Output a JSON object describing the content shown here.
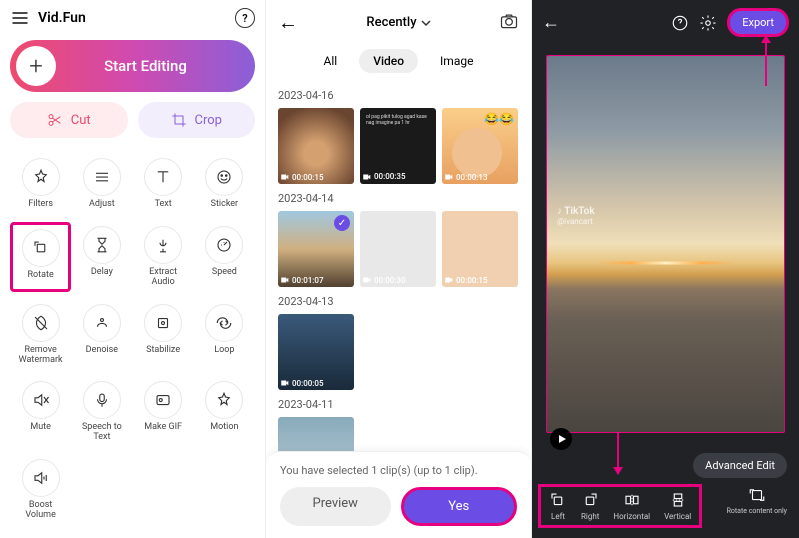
{
  "pane1": {
    "app_name": "Vid.Fun",
    "start_label": "Start Editing",
    "pills": {
      "cut": "Cut",
      "crop": "Crop"
    },
    "tools": [
      {
        "id": "filters",
        "label": "Filters"
      },
      {
        "id": "adjust",
        "label": "Adjust"
      },
      {
        "id": "text",
        "label": "Text"
      },
      {
        "id": "sticker",
        "label": "Sticker"
      },
      {
        "id": "rotate",
        "label": "Rotate",
        "highlighted": true
      },
      {
        "id": "delay",
        "label": "Delay"
      },
      {
        "id": "extract-audio",
        "label": "Extract\nAudio"
      },
      {
        "id": "speed",
        "label": "Speed"
      },
      {
        "id": "remove-watermark",
        "label": "Remove\nWatermark"
      },
      {
        "id": "denoise",
        "label": "Denoise"
      },
      {
        "id": "stabilize",
        "label": "Stabilize"
      },
      {
        "id": "loop",
        "label": "Loop"
      },
      {
        "id": "mute",
        "label": "Mute"
      },
      {
        "id": "speech-to-text",
        "label": "Speech to\nText"
      },
      {
        "id": "make-gif",
        "label": "Make GIF"
      },
      {
        "id": "motion",
        "label": "Motion"
      },
      {
        "id": "boost-volume",
        "label": "Boost\nVolume"
      }
    ]
  },
  "pane2": {
    "dropdown_label": "Recently",
    "tabs": {
      "all": "All",
      "video": "Video",
      "image": "Image",
      "active": "video"
    },
    "groups": [
      {
        "date": "2023-04-16",
        "items": [
          {
            "dur": "00:00:15"
          },
          {
            "dur": "00:00:35",
            "caption": "ol pag pikit tulog agad kase nag imagine pa 1 hr"
          },
          {
            "dur": "00:00:13"
          }
        ]
      },
      {
        "date": "2023-04-14",
        "items": [
          {
            "dur": "00:01:07",
            "selected": true
          },
          {
            "dur": "00:00:30"
          },
          {
            "dur": "00:00:15"
          }
        ]
      },
      {
        "date": "2023-04-13",
        "items": [
          {
            "dur": "00:00:05"
          }
        ]
      },
      {
        "date": "2023-04-11",
        "items": [
          {
            "dur": ""
          }
        ]
      }
    ],
    "selection_text": "You have selected 1 clip(s) (up to 1 clip).",
    "preview_btn": "Preview",
    "yes_btn": "Yes"
  },
  "pane3": {
    "export_label": "Export",
    "watermark_app": "TikTok",
    "watermark_user": "@ivancart",
    "advanced_edit": "Advanced Edit",
    "rotate_options": [
      {
        "id": "left",
        "label": "Left"
      },
      {
        "id": "right",
        "label": "Right"
      },
      {
        "id": "horizontal",
        "label": "Horizontal"
      },
      {
        "id": "vertical",
        "label": "Vertical"
      }
    ],
    "rotate_content_only": "Rotate content only"
  },
  "colors": {
    "accent_magenta": "#e6007e",
    "accent_purple": "#6b4de6"
  }
}
